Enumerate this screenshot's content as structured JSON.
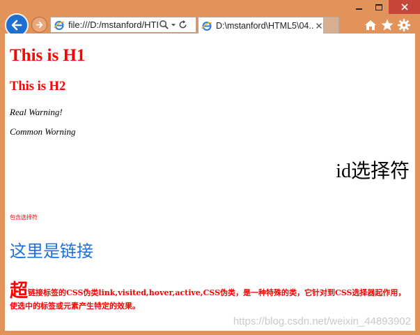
{
  "browser": {
    "address_url": "file:///D:/mstanford/HTI",
    "tab_title": "D:\\mstanford\\HTML5\\04..."
  },
  "page": {
    "h1": "This is H1",
    "h2": "This is H2",
    "real_warning": "Real Warning!",
    "common_warning": "Common Worning",
    "id_selector": "id选择符",
    "contain_selector": "包含选择符",
    "link_text": "这里是链接",
    "paragraph_big": "超",
    "paragraph_text": "链接标签的CSS伪类link,visited,hover,active,CSS伪类，是一种特殊的类，它针对到CSS选择器起作用，使选中的标签或元素产生特定的效果。"
  },
  "watermark": "https://blog.csdn.net/weixin_44893902",
  "colors": {
    "frame": "#e1935a",
    "close": "#c7463a",
    "heading_red": "#ff0000",
    "link_blue": "#1e6fd9"
  }
}
